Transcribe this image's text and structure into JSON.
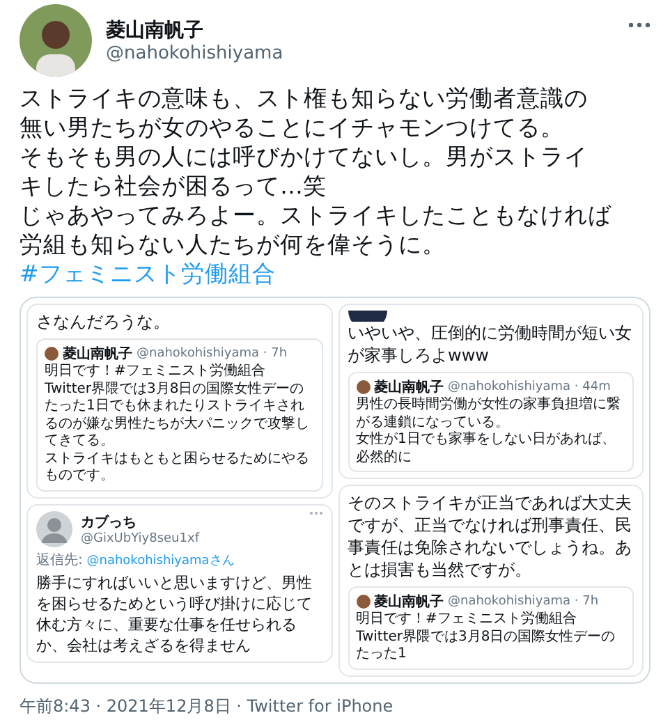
{
  "author": {
    "name": "菱山南帆子",
    "handle": "@nahokohishiyama"
  },
  "tweet": {
    "lines": [
      "ストライキの意味も、スト権も知らない労働者意識の",
      "無い男たちが女のやることにイチャモンつけてる。",
      "そもそも男の人には呼びかけてないし。男がストライ",
      "キしたら社会が困るって…笑",
      "じゃあやってみろよー。ストライキしたこともなければ",
      "労組も知らない人たちが何を偉そうに。"
    ],
    "hashtag": "#フェミニスト労働組合"
  },
  "attached_image": {
    "columns": [
      {
        "panels": [
          {
            "kind": "post",
            "avatar": false,
            "text": "さなんだろうな。",
            "quote": {
              "name": "菱山南帆子",
              "meta": "@nahokohishiyama · 7h",
              "paragraphs": [
                "明日です！#フェミニスト労働組合",
                "Twitter界隈では3月8日の国際女性デーのたった1日でも休まれたりストライキされるのが嫌な男性たちが大パニックで攻撃してきてる。",
                "ストライキはもともと困らせるためにやるものです。"
              ]
            }
          },
          {
            "kind": "reply",
            "name": "カブっち",
            "handle": "@GixUbYiy8seu1xf",
            "reply_label": "返信先:",
            "reply_to": "@nahokohishiyamaさん",
            "text": "勝手にすればいいと思いますけど、男性を困らせるためという呼び掛けに応じて休む方々に、重要な仕事を任せられるか、会社は考えざるを得ません"
          }
        ]
      },
      {
        "panels": [
          {
            "kind": "post",
            "avatar": true,
            "text": "いやいや、圧倒的に労働時間が短い女が家事しろよwww",
            "quote": {
              "name": "菱山南帆子",
              "meta": "@nahokohishiyama · 44m",
              "paragraphs": [
                "男性の長時間労働が女性の家事負担増に繋がる連鎖になっている。",
                "女性が1日でも家事をしない日があれば、必然的に"
              ]
            }
          },
          {
            "kind": "post",
            "avatar": false,
            "text": "そのストライキが正当であれば大丈夫ですが、正当でなければ刑事責任、民事責任は免除されないでしょうね。あとは損害も当然ですが。",
            "quote": {
              "name": "菱山南帆子",
              "meta": "@nahokohishiyama · 7h",
              "paragraphs": [
                "明日です！#フェミニスト労働組合",
                "Twitter界隈では3月8日の国際女性デーのたった1"
              ]
            }
          }
        ]
      }
    ]
  },
  "footer": "午前8:43 · 2021年12月8日 · Twitter for iPhone"
}
